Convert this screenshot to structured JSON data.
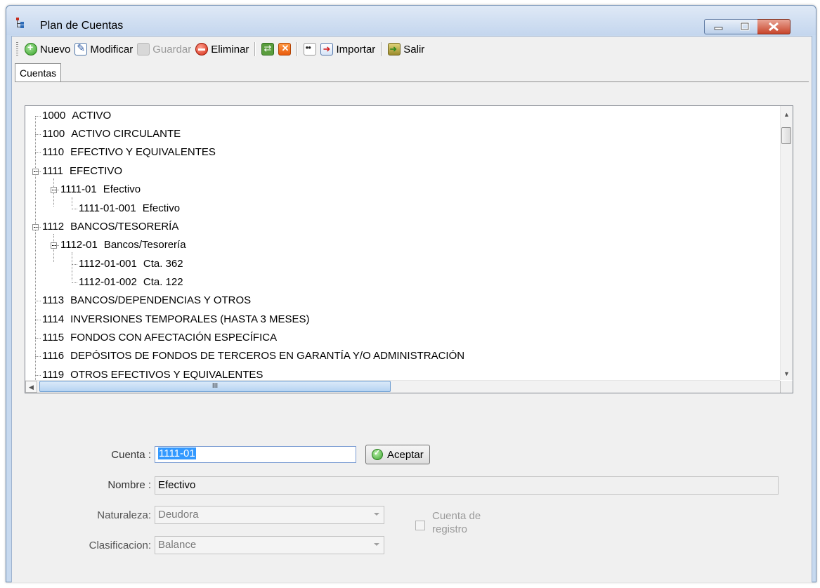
{
  "window": {
    "title": "Plan de Cuentas"
  },
  "toolbar": {
    "nuevo": "Nuevo",
    "modificar": "Modificar",
    "guardar": "Guardar",
    "eliminar": "Eliminar",
    "importar": "Importar",
    "salir": "Salir"
  },
  "tabs": {
    "cuentas": "Cuentas"
  },
  "tree": {
    "nodes": [
      {
        "code": "1000",
        "name": "ACTIVO"
      },
      {
        "code": "1100",
        "name": "ACTIVO CIRCULANTE"
      },
      {
        "code": "1110",
        "name": "EFECTIVO Y EQUIVALENTES"
      },
      {
        "code": "1111",
        "name": "EFECTIVO"
      },
      {
        "code": "1111-01",
        "name": "Efectivo"
      },
      {
        "code": "1111-01-001",
        "name": "Efectivo"
      },
      {
        "code": "1112",
        "name": "BANCOS/TESORERÍA"
      },
      {
        "code": "1112-01",
        "name": "Bancos/Tesorería"
      },
      {
        "code": "1112-01-001",
        "name": "Cta. 362"
      },
      {
        "code": "1112-01-002",
        "name": "Cta. 122"
      },
      {
        "code": "1113",
        "name": "BANCOS/DEPENDENCIAS Y OTROS"
      },
      {
        "code": "1114",
        "name": "INVERSIONES TEMPORALES (HASTA 3 MESES)"
      },
      {
        "code": "1115",
        "name": "FONDOS CON AFECTACIÓN ESPECÍFICA"
      },
      {
        "code": "1116",
        "name": "DEPÓSITOS DE FONDOS DE TERCEROS EN GARANTÍA Y/O ADMINISTRACIÓN"
      },
      {
        "code": "1119",
        "name": "OTROS EFECTIVOS Y EQUIVALENTES"
      }
    ],
    "hscroll_grip": "III"
  },
  "form": {
    "cuenta_label": "Cuenta :",
    "cuenta_value": "1111-01",
    "aceptar_label": "Aceptar",
    "nombre_label": "Nombre :",
    "nombre_value": "Efectivo",
    "naturaleza_label": "Naturaleza:",
    "naturaleza_value": "Deudora",
    "clasificacion_label": "Clasificacion:",
    "clasificacion_value": "Balance",
    "registro_line1": "Cuenta de",
    "registro_line2": "registro"
  }
}
